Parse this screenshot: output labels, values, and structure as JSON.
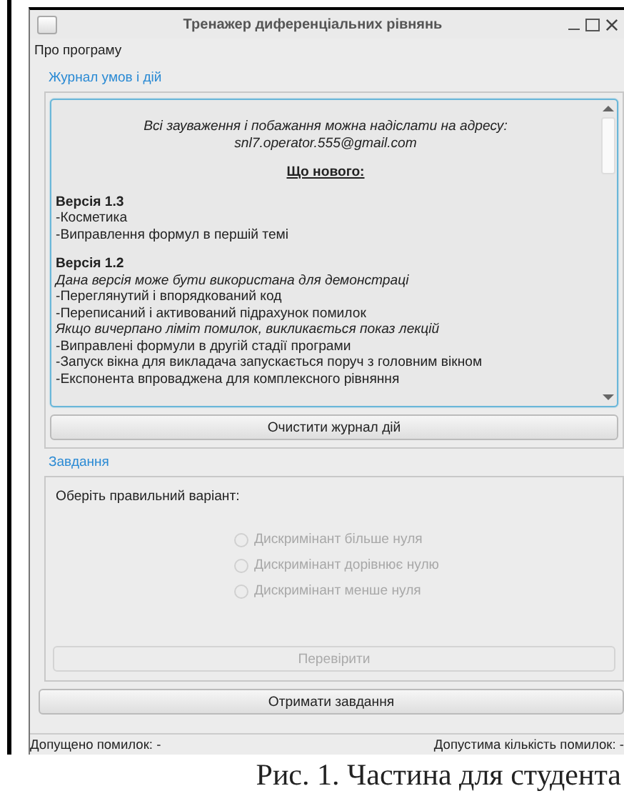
{
  "window": {
    "title": "Тренажер диференціальних рівнянь"
  },
  "menu": [
    {
      "label": "Про програму"
    }
  ],
  "log_group": {
    "title": "Журнал умов і дій",
    "lines": [
      {
        "kind": "note",
        "text": "Всі зауваження і побажання можна надіслати на адресу:"
      },
      {
        "kind": "note",
        "text": "snl7.operator.555@gmail.com"
      },
      {
        "kind": "heading",
        "text": "Що нового:"
      },
      {
        "kind": "version",
        "text": "Версія 1.3"
      },
      {
        "kind": "item",
        "text": "-Косметика"
      },
      {
        "kind": "item",
        "text": "-Виправлення формул в першій темі"
      },
      {
        "kind": "version",
        "text": "Версія 1.2"
      },
      {
        "kind": "remark",
        "text": "Дана версія може бути використана для демонстраці"
      },
      {
        "kind": "item",
        "text": "-Переглянутий і впорядкований код"
      },
      {
        "kind": "item",
        "text": "-Переписаний і активований підрахунок помилок"
      },
      {
        "kind": "remark",
        "text": "Якщо вичерпано ліміт помилок, викликається показ лекцій"
      },
      {
        "kind": "item",
        "text": "-Виправлені формули в другій стадії програми"
      },
      {
        "kind": "item",
        "text": "-Запуск вікна для викладача запускається поруч з головним вікном"
      },
      {
        "kind": "item",
        "text": "-Експонента впроваджена для комплексного рівняння"
      }
    ],
    "clear_button": "Очистити журнал дій"
  },
  "task_group": {
    "title": "Завдання",
    "prompt": "Оберіть правильний варіант:",
    "options": [
      {
        "label": "Дискримінант більше нуля",
        "selected": false,
        "disabled": true
      },
      {
        "label": "Дискримінант дорівнює нулю",
        "selected": false,
        "disabled": true
      },
      {
        "label": "Дискримінант менше нуля",
        "selected": false,
        "disabled": true
      }
    ],
    "check_button": {
      "label": "Перевірити",
      "disabled": true
    }
  },
  "get_task_button": "Отримати завдання",
  "status_bar": {
    "left": "Допущено помилок: -",
    "right": "Допустима кількість помилок: -"
  },
  "caption": "Рис. 1. Частина для студента"
}
